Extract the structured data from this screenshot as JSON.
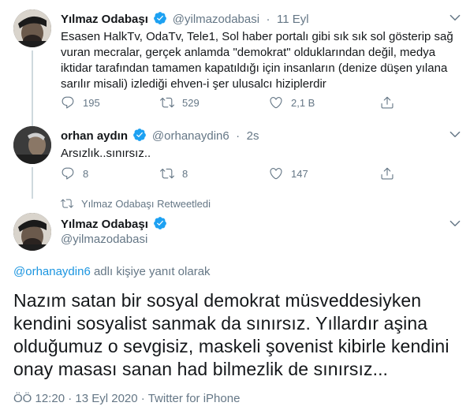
{
  "tweet1": {
    "name": "Yılmaz Odabaşı",
    "handle": "@yilmazodabasi",
    "separator": "·",
    "time": "11 Eyl",
    "text_lines": [
      "Esasen HalkTv, OdaTv, Tele1, Sol haber portalı gibi sık sık sol gösterip sağ",
      "vuran mecralar,  gerçek anlamda \"demokrat\" olduklarından değil, medya",
      "iktidar tarafından tamamen kapatıldığı için insanların (denize düşen yılana",
      "sarılır misali) izlediği ehven-i şer ulusalcı hiziplerdir"
    ],
    "replies": "195",
    "retweets": "529",
    "likes": "2,1 B"
  },
  "tweet2": {
    "name": "orhan aydın",
    "handle": "@orhanaydin6",
    "separator": "·",
    "time": "2s",
    "text": "Arsızlık..sınırsız..",
    "replies": "8",
    "retweets": "8",
    "likes": "147"
  },
  "retweet_banner": "Yılmaz Odabaşı Retweetledi",
  "tweet3": {
    "name": "Yılmaz Odabaşı",
    "handle": "@yilmazodabasi",
    "reply_mention": "@orhanaydin6",
    "reply_suffix": " adlı kişiye yanıt olarak",
    "text_lines": [
      "Nazım satan bir sosyal demokrat müsveddesiyken",
      "kendini sosyalist sanmak da sınırsız. Yıllardır aşina",
      "olduğumuz o sevgisiz, maskeli şovenist kibirle kendini",
      "onay masası sanan had bilmezlik de sınırsız..."
    ],
    "time": "ÖÖ 12:20",
    "separator": " · ",
    "date": "13 Eyl 2020",
    "client": "Twitter for iPhone"
  },
  "colors": {
    "verified": "#1da1f2",
    "secondary_text": "#657786",
    "link": "#1b95e0",
    "thread_line": "#cfd9de"
  }
}
